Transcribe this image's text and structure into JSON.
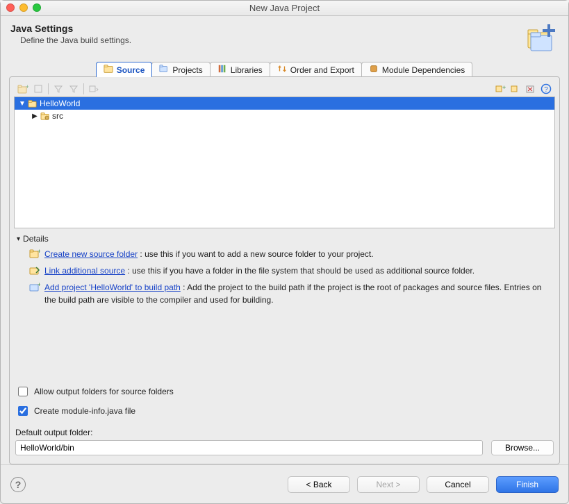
{
  "window": {
    "title": "New Java Project"
  },
  "header": {
    "title": "Java Settings",
    "subtitle": "Define the Java build settings."
  },
  "tabs": {
    "items": [
      {
        "label": "Source",
        "active": true
      },
      {
        "label": "Projects"
      },
      {
        "label": "Libraries"
      },
      {
        "label": "Order and Export"
      },
      {
        "label": "Module Dependencies"
      }
    ]
  },
  "tree": {
    "project": "HelloWorld",
    "children": [
      {
        "label": "src"
      }
    ]
  },
  "details": {
    "header": "Details",
    "items": [
      {
        "link": "Create new source folder",
        "rest": ": use this if you want to add a new source folder to your project."
      },
      {
        "link": "Link additional source",
        "rest": ": use this if you have a folder in the file system that should be used as additional source folder."
      },
      {
        "link": "Add project 'HelloWorld' to build path",
        "rest": ": Add the project to the build path if the project is the root of packages and source files. Entries on the build path are visible to the compiler and used for building."
      }
    ]
  },
  "options": {
    "allow_output_label": "Allow output folders for source folders",
    "allow_output_checked": false,
    "create_module_label": "Create module-info.java file",
    "create_module_checked": true
  },
  "output": {
    "label": "Default output folder:",
    "value": "HelloWorld/bin",
    "browse": "Browse..."
  },
  "buttons": {
    "back": "< Back",
    "next": "Next >",
    "cancel": "Cancel",
    "finish": "Finish"
  }
}
